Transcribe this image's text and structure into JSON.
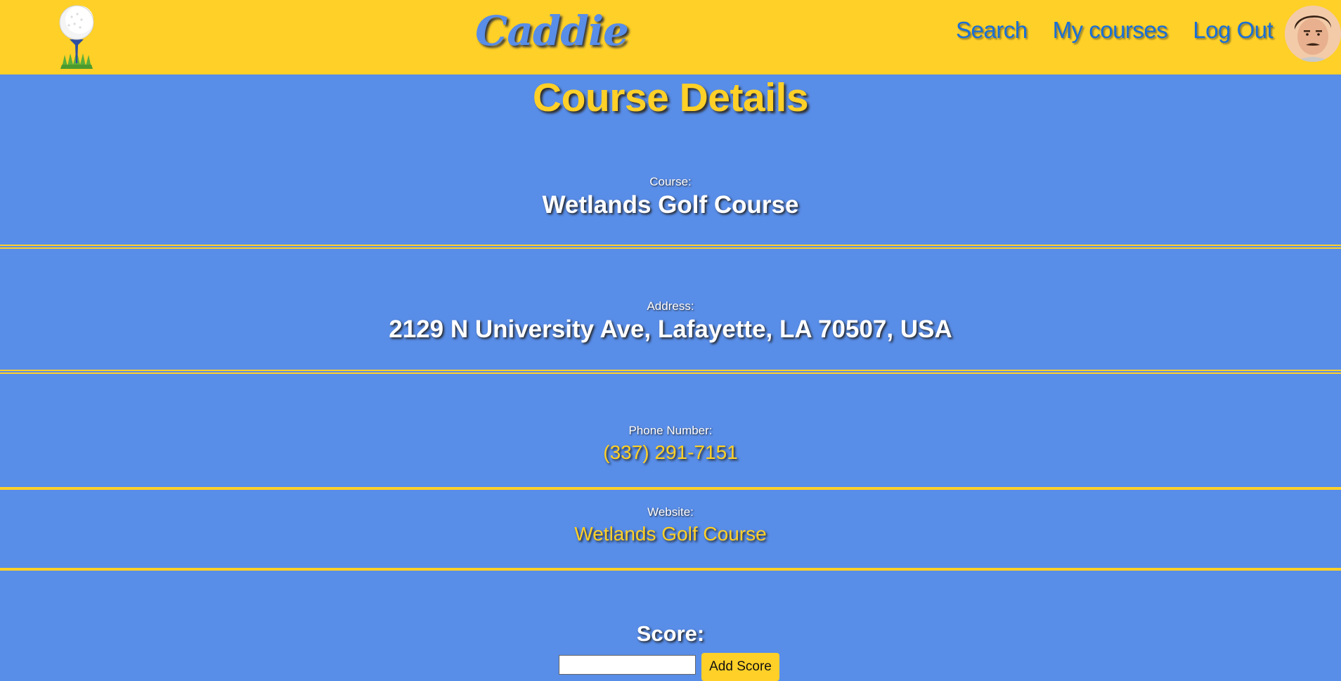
{
  "header": {
    "brand": "Caddie",
    "nav": [
      "Search",
      "My courses",
      "Log Out"
    ],
    "logo_icon": "golf-ball-on-tee-icon",
    "avatar": "user-avatar"
  },
  "page": {
    "title": "Course Details"
  },
  "course": {
    "course_label": "Course:",
    "course_name": "Wetlands Golf Course",
    "address_label": "Address:",
    "address": "2129 N University Ave, Lafayette, LA 70507, USA",
    "phone_label": "Phone Number:",
    "phone": "(337) 291-7151",
    "website_label": "Website:",
    "website": "Wetlands Golf Course"
  },
  "score": {
    "label": "Score:",
    "input_value": "",
    "button_label": "Add Score"
  },
  "colors": {
    "background": "#588de8",
    "accent": "#ffd027",
    "nav_link": "#1a6fd6"
  }
}
